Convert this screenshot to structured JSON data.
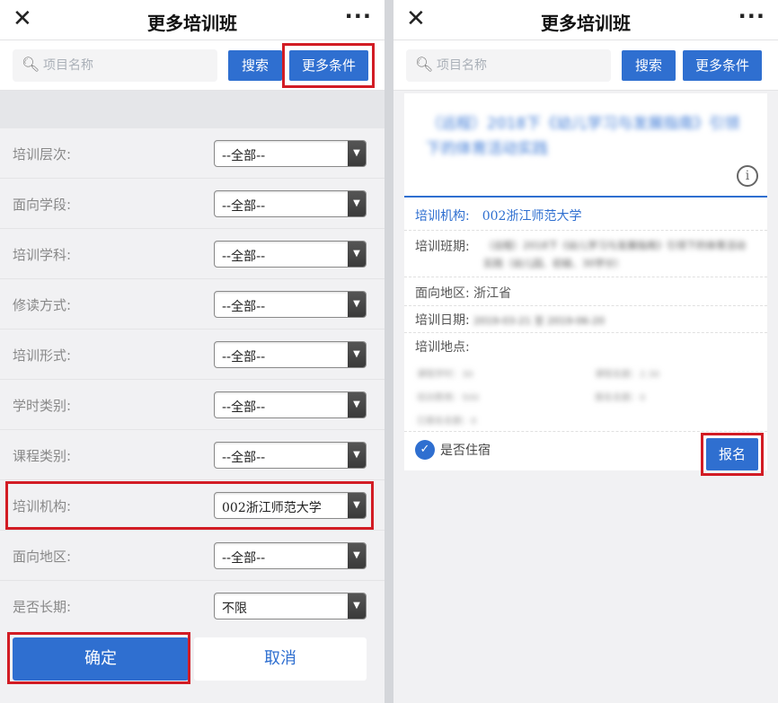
{
  "left": {
    "header": {
      "close": "✕",
      "title": "更多培训班",
      "more": "···"
    },
    "search": {
      "placeholder": "项目名称",
      "search_label": "搜索",
      "more_label": "更多条件"
    },
    "filters": [
      {
        "label": "培训层次:",
        "value": "--全部--"
      },
      {
        "label": "面向学段:",
        "value": "--全部--"
      },
      {
        "label": "培训学科:",
        "value": "--全部--"
      },
      {
        "label": "修读方式:",
        "value": "--全部--"
      },
      {
        "label": "培训形式:",
        "value": "--全部--"
      },
      {
        "label": "学时类别:",
        "value": "--全部--"
      },
      {
        "label": "课程类别:",
        "value": "--全部--"
      },
      {
        "label": "培训机构:",
        "value": "002浙江师范大学"
      },
      {
        "label": "面向地区:",
        "value": "--全部--"
      },
      {
        "label": "是否长期:",
        "value": "不限"
      }
    ],
    "confirm_label": "确定",
    "cancel_label": "取消"
  },
  "right": {
    "header": {
      "close": "✕",
      "title": "更多培训班",
      "more": "···"
    },
    "search": {
      "placeholder": "项目名称",
      "search_label": "搜索",
      "more_label": "更多条件"
    },
    "card": {
      "title": "（远程）2018下《幼儿学习与发展指南》引领下的体育活动实践",
      "info_icon": "i",
      "org_label": "培训机构:",
      "org_value": "002浙江师范大学",
      "class_label": "培训班期:",
      "class_value": "（远程）2018下《幼儿学习与发展指南》引领下的体育活动实践（幼儿园、初级、30学分）",
      "region_label": "面向地区:",
      "region_value": "浙江省",
      "date_label": "培训日期:",
      "date_value": "2019-03-21 至 2019-06-20",
      "location_label": "培训地点:",
      "small": [
        [
          "课程学时：30",
          "课程名额：2.30"
        ],
        [
          "培训费用：500",
          "报名名额：0"
        ],
        [
          "已报名名额：0"
        ]
      ],
      "lodging_label": "是否住宿",
      "signup_label": "报名"
    }
  },
  "colors": {
    "accent": "#2f6fd0",
    "highlight": "#d21c24",
    "background": "#f1f1f3"
  }
}
